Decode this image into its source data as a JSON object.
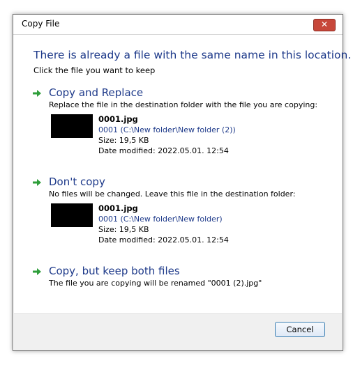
{
  "window": {
    "title": "Copy File",
    "close_glyph": "✕"
  },
  "dialog": {
    "heading": "There is already a file with the same name in this location.",
    "subheading": "Click the file you want to keep"
  },
  "options": {
    "replace": {
      "title": "Copy and Replace",
      "description": "Replace the file in the destination folder with the file you are copying:",
      "file": {
        "name": "0001.jpg",
        "path": "0001 (C:\\New folder\\New folder (2))",
        "size": "Size: 19,5 KB",
        "date": "Date modified: 2022.05.01. 12:54"
      }
    },
    "dont_copy": {
      "title": "Don't copy",
      "description": "No files will be changed. Leave this file in the destination folder:",
      "file": {
        "name": "0001.jpg",
        "path": "0001 (C:\\New folder\\New folder)",
        "size": "Size: 19,5 KB",
        "date": "Date modified: 2022.05.01. 12:54"
      }
    },
    "keep_both": {
      "title": "Copy, but keep both files",
      "description": "The file you are copying will be renamed \"0001 (2).jpg\""
    }
  },
  "footer": {
    "cancel_label": "Cancel"
  },
  "icons": {
    "option_arrow": "green-arrow-icon",
    "close": "close-icon"
  },
  "colors": {
    "heading": "#1e3a8a",
    "arrow": "#2e9e3a",
    "close_button": "#c7473a"
  }
}
